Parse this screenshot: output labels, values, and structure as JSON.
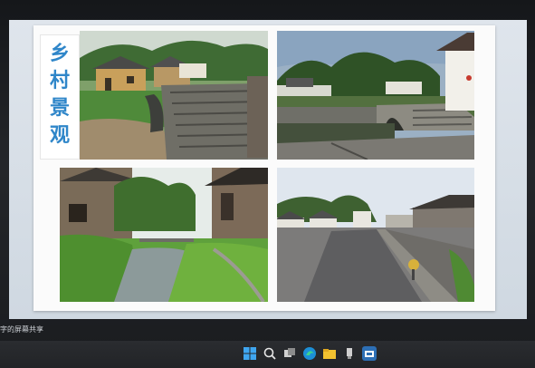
{
  "slide": {
    "title_chars": [
      "乡",
      "村",
      "景",
      "观"
    ],
    "photos": [
      {
        "id": "top-left",
        "watermark": ""
      },
      {
        "id": "top-right",
        "watermark": ""
      },
      {
        "id": "bottom-left",
        "watermark": ""
      },
      {
        "id": "bottom-right",
        "watermark": ""
      }
    ]
  },
  "share_label": "字的屏幕共享",
  "taskbar": {
    "icons": [
      "windows-start-icon",
      "search-icon",
      "task-view-icon",
      "edge-browser-icon",
      "file-explorer-icon",
      "usb-icon",
      "meeting-app-icon"
    ]
  },
  "colors": {
    "title": "#2f86c9",
    "slide_bg": "#fbfbfb",
    "taskbar": "#2a2c30"
  }
}
